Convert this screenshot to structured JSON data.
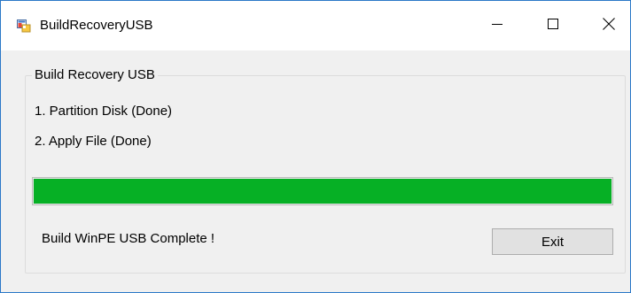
{
  "window": {
    "title": "BuildRecoveryUSB",
    "icon": "app-window-icon",
    "controls": [
      "minimize-icon",
      "maximize-icon",
      "close-icon"
    ]
  },
  "group": {
    "title": "Build Recovery USB",
    "steps": [
      "1. Partition Disk (Done)",
      "2. Apply File (Done)"
    ]
  },
  "progress": {
    "value_percent": 100,
    "fill_color": "#06b025"
  },
  "status": {
    "text": "Build WinPE USB Complete !"
  },
  "buttons": {
    "exit_label": "Exit"
  },
  "colors": {
    "window_border": "#2b78c8",
    "background": "#f0f0f0"
  }
}
